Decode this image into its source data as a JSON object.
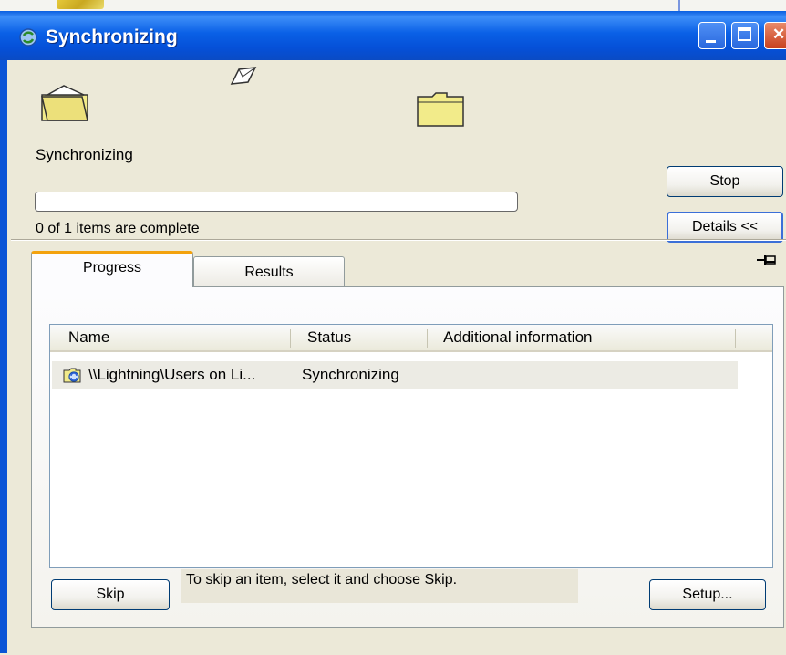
{
  "window": {
    "title": "Synchronizing"
  },
  "status": {
    "label": "Synchronizing",
    "items_complete": "0 of 1 items are complete",
    "progress_fraction": 0
  },
  "buttons": {
    "stop": "Stop",
    "details": "Details <<",
    "skip": "Skip",
    "setup": "Setup..."
  },
  "tabs": [
    {
      "label": "Progress",
      "active": true
    },
    {
      "label": "Results",
      "active": false
    }
  ],
  "list": {
    "columns": [
      "Name",
      "Status",
      "Additional information"
    ],
    "rows": [
      {
        "name": "\\\\Lightning\\Users on Li...",
        "status": "Synchronizing",
        "info": ""
      }
    ]
  },
  "hint": "To skip an item, select it and choose Skip.",
  "colors": {
    "titlebar": "#0a5fe0",
    "window_bg": "#ece9d8",
    "active_tab_accent": "#f3a20d",
    "folder": "#f2eb8a"
  },
  "icons": [
    "sync-app-icon",
    "source-folder-icon",
    "flying-paper-icon",
    "destination-folder-icon",
    "pushpin-icon",
    "offline-folder-icon"
  ]
}
